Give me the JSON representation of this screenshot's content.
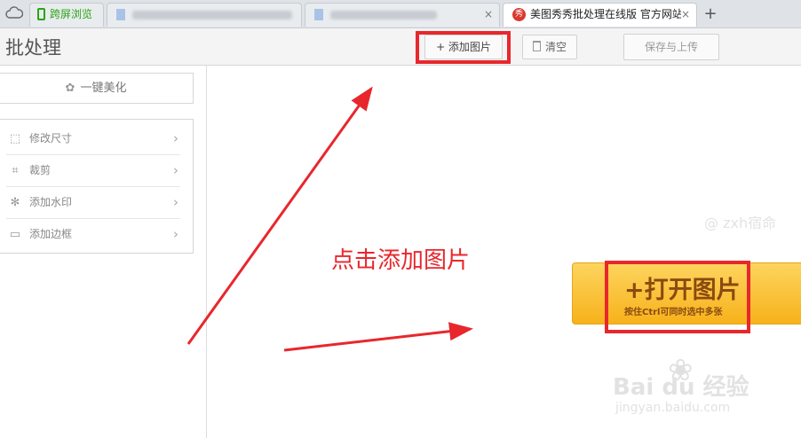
{
  "browser": {
    "tabs": [
      {
        "label": "",
        "active": false
      },
      {
        "label": "跨屏浏览",
        "active": false
      },
      {
        "label": "",
        "active": false
      },
      {
        "label": "",
        "active": false
      },
      {
        "label": "美图秀秀批处理在线版 官方网站",
        "active": true,
        "close": "×"
      }
    ],
    "new_tab": "+"
  },
  "header": {
    "title": "批处理",
    "add_image": "+ 添加图片",
    "clear": "清空",
    "save_upload": "保存与上传"
  },
  "sidebar": {
    "one_click": "一键美化",
    "items": [
      {
        "label": "修改尺寸",
        "icon": "resize-icon"
      },
      {
        "label": "裁剪",
        "icon": "crop-icon"
      },
      {
        "label": "添加水印",
        "icon": "watermark-icon"
      },
      {
        "label": "添加边框",
        "icon": "frame-icon"
      }
    ]
  },
  "annotation": {
    "text": "点击添加图片",
    "color": "#e8272c"
  },
  "open_image": {
    "label": "+打开图片",
    "hint": "按住Ctrl可同时选中多张"
  },
  "watermarks": {
    "user": "@ zxh宿命",
    "baidu_logo": "Bai du 经验",
    "baidu_url": "jingyan.baidu.com"
  },
  "colors": {
    "accent": "#e8272c",
    "open_btn": "#fbc129"
  }
}
